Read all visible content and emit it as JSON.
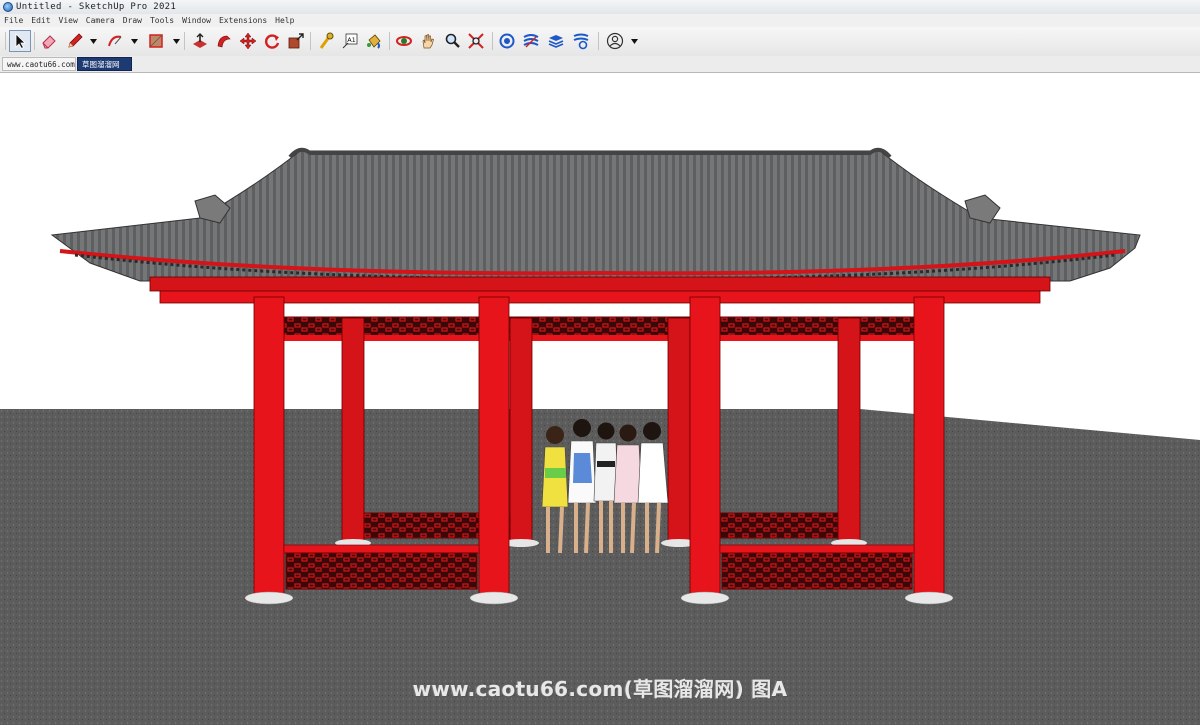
{
  "window": {
    "title": "Untitled - SketchUp Pro 2021"
  },
  "menu": [
    "File",
    "Edit",
    "View",
    "Camera",
    "Draw",
    "Tools",
    "Window",
    "Extensions",
    "Help"
  ],
  "toolbar": {
    "tools": [
      {
        "name": "select-tool",
        "icon": "arrow-cursor-icon"
      },
      {
        "name": "eraser-tool",
        "icon": "eraser-icon"
      },
      {
        "name": "line-tool",
        "icon": "pencil-icon"
      },
      {
        "name": "arc-tool",
        "icon": "arc-icon"
      },
      {
        "name": "shape-tool",
        "icon": "rectangle-icon"
      },
      {
        "name": "push-pull-tool",
        "icon": "push-pull-icon"
      },
      {
        "name": "follow-me-tool",
        "icon": "follow-me-icon"
      },
      {
        "name": "move-tool",
        "icon": "move-arrows-icon"
      },
      {
        "name": "rotate-tool",
        "icon": "rotate-icon"
      },
      {
        "name": "scale-tool",
        "icon": "scale-icon"
      },
      {
        "name": "tape-measure-tool",
        "icon": "tape-measure-icon"
      },
      {
        "name": "text-tool",
        "icon": "text-label-icon"
      },
      {
        "name": "paint-bucket-tool",
        "icon": "paint-bucket-icon"
      },
      {
        "name": "orbit-tool",
        "icon": "orbit-icon"
      },
      {
        "name": "pan-tool",
        "icon": "hand-icon"
      },
      {
        "name": "zoom-tool",
        "icon": "magnifier-icon"
      },
      {
        "name": "zoom-extents-tool",
        "icon": "zoom-extents-icon"
      },
      {
        "name": "warehouse-tool",
        "icon": "3d-warehouse-icon"
      },
      {
        "name": "extension-warehouse-tool",
        "icon": "extension-warehouse-icon"
      },
      {
        "name": "layout-tool",
        "icon": "layout-icon"
      },
      {
        "name": "extension-manager-tool",
        "icon": "extension-manager-icon"
      },
      {
        "name": "account-tool",
        "icon": "user-account-icon"
      }
    ],
    "text_tool_label": "A1"
  },
  "tabs": [
    "www.caotu66.com",
    "草图溜溜网"
  ],
  "scene": {
    "sky_color": "#ffffff",
    "ground_color": "#5a5a5a",
    "column_color": "#e8141c",
    "roof_color": "#6f7173",
    "people_count": 5
  },
  "watermark": "www.caotu66.com(草图溜溜网) 图A"
}
